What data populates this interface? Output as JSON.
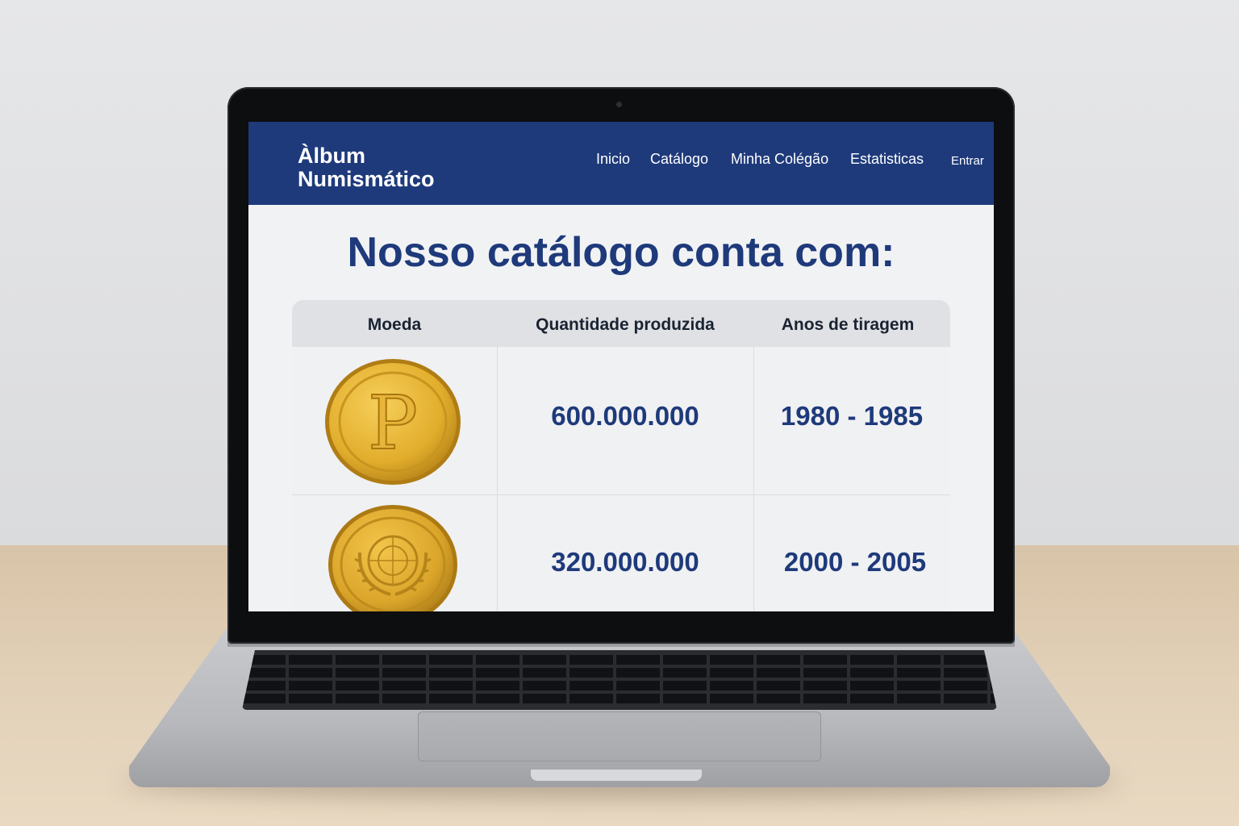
{
  "site": {
    "brand_line1": "Àlbum",
    "brand_line2": "Numismático",
    "nav": {
      "items": [
        "Inicio",
        "Catálogo",
        "Minha Colégão",
        "Estatisticas"
      ],
      "login": "Entrar"
    },
    "headline": "Nosso catálogo conta com:",
    "table": {
      "headers": [
        "Moeda",
        "Quantidade produzida",
        "Anos de tiragem"
      ],
      "rows": [
        {
          "coin_icon": "coin-letter-p-icon",
          "coin_letter": "P",
          "quantity": "600.000.000",
          "years": "1980 - 1985"
        },
        {
          "coin_icon": "coin-emblem-icon",
          "quantity": "320.000.000",
          "years": "2000 - 2005"
        }
      ]
    }
  },
  "colors": {
    "nav_bg": "#1e3a7b",
    "headline": "#1e3a7b",
    "coin_gold": "#e2ad2c",
    "page_bg": "#f1f2f4"
  }
}
